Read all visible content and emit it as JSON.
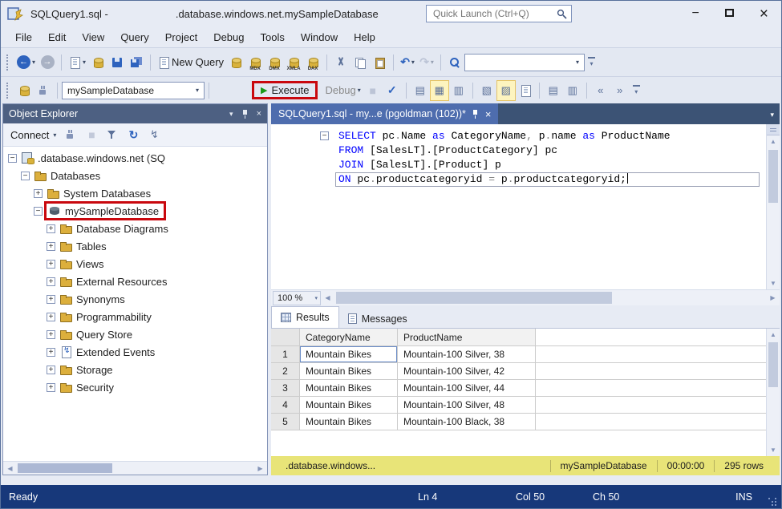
{
  "window": {
    "title_left": "SQLQuery1.sql -",
    "title_right": ".database.windows.net.mySampleDatabase",
    "quick_launch_placeholder": "Quick Launch (Ctrl+Q)"
  },
  "menu": {
    "items": [
      "File",
      "Edit",
      "View",
      "Query",
      "Project",
      "Debug",
      "Tools",
      "Window",
      "Help"
    ]
  },
  "toolbar1": {
    "new_query_label": "New Query",
    "query_types": [
      "",
      "MDX",
      "DMX",
      "XMLA",
      "DAX"
    ]
  },
  "toolbar2": {
    "database_combo_value": "mySampleDatabase",
    "execute_label": "Execute",
    "debug_label": "Debug"
  },
  "object_explorer": {
    "title": "Object Explorer",
    "connect_label": "Connect",
    "tree": [
      {
        "label": ".database.windows.net (SQ",
        "level": 0,
        "expand": "minus",
        "icon": "server"
      },
      {
        "label": "Databases",
        "level": 1,
        "expand": "minus",
        "icon": "folder"
      },
      {
        "label": "System Databases",
        "level": 2,
        "expand": "plus",
        "icon": "folder"
      },
      {
        "label": "mySampleDatabase",
        "level": 2,
        "expand": "minus",
        "icon": "database",
        "highlight": true
      },
      {
        "label": "Database Diagrams",
        "level": 3,
        "expand": "plus",
        "icon": "folder"
      },
      {
        "label": "Tables",
        "level": 3,
        "expand": "plus",
        "icon": "folder"
      },
      {
        "label": "Views",
        "level": 3,
        "expand": "plus",
        "icon": "folder"
      },
      {
        "label": "External Resources",
        "level": 3,
        "expand": "plus",
        "icon": "folder"
      },
      {
        "label": "Synonyms",
        "level": 3,
        "expand": "plus",
        "icon": "folder"
      },
      {
        "label": "Programmability",
        "level": 3,
        "expand": "plus",
        "icon": "folder"
      },
      {
        "label": "Query Store",
        "level": 3,
        "expand": "plus",
        "icon": "folder"
      },
      {
        "label": "Extended Events",
        "level": 3,
        "expand": "plus",
        "icon": "events"
      },
      {
        "label": "Storage",
        "level": 3,
        "expand": "plus",
        "icon": "folder"
      },
      {
        "label": "Security",
        "level": 3,
        "expand": "plus",
        "icon": "folder"
      }
    ]
  },
  "editor": {
    "tab_title": "SQLQuery1.sql - my...e (pgoldman (102))*",
    "zoom_level": "100 %",
    "code": [
      {
        "outline": true,
        "tokens": [
          [
            "SELECT ",
            "kw"
          ],
          [
            "pc",
            "id"
          ],
          [
            ".",
            "op"
          ],
          [
            "Name ",
            "id"
          ],
          [
            "as",
            "kw"
          ],
          [
            " CategoryName",
            "id"
          ],
          [
            ", ",
            "op"
          ],
          [
            "p",
            "id"
          ],
          [
            ".",
            "op"
          ],
          [
            "name ",
            "id"
          ],
          [
            "as",
            "kw"
          ],
          [
            " ProductName",
            "id"
          ]
        ]
      },
      {
        "tokens": [
          [
            "FROM ",
            "kw"
          ],
          [
            "[SalesLT].[ProductCategory] pc",
            "id"
          ]
        ]
      },
      {
        "tokens": [
          [
            "JOIN ",
            "kw"
          ],
          [
            "[SalesLT].[Product] p",
            "id"
          ]
        ]
      },
      {
        "current": true,
        "tokens": [
          [
            "ON ",
            "kw"
          ],
          [
            "pc",
            "id"
          ],
          [
            ".",
            "op"
          ],
          [
            "productcategoryid ",
            "id"
          ],
          [
            "=",
            "op"
          ],
          [
            " p",
            "id"
          ],
          [
            ".",
            "op"
          ],
          [
            "productcategoryid;",
            "id"
          ]
        ]
      }
    ]
  },
  "results": {
    "tabs": [
      "Results",
      "Messages"
    ],
    "columns": [
      "CategoryName",
      "ProductName"
    ],
    "rows": [
      [
        "Mountain Bikes",
        "Mountain-100 Silver, 38"
      ],
      [
        "Mountain Bikes",
        "Mountain-100 Silver, 42"
      ],
      [
        "Mountain Bikes",
        "Mountain-100 Silver, 44"
      ],
      [
        "Mountain Bikes",
        "Mountain-100 Silver, 48"
      ],
      [
        "Mountain Bikes",
        "Mountain-100 Black, 38"
      ]
    ],
    "status": {
      "server": ".database.windows...",
      "database": "mySampleDatabase",
      "time": "00:00:00",
      "row_count": "295 rows"
    }
  },
  "status_bar": {
    "state": "Ready",
    "line": "Ln 4",
    "column": "Col 50",
    "char": "Ch 50",
    "mode": "INS"
  },
  "icons": {
    "back": "←",
    "forward": "→",
    "caret": "▾",
    "undo": "↶",
    "redo": "↷",
    "refresh": "↻",
    "play": "▶",
    "stop": "■",
    "check": "✓",
    "close": "×",
    "minimize": "−",
    "up": "▲",
    "down": "▼",
    "left": "◀",
    "right": "▶",
    "bolt": "↯",
    "results-text": "▤",
    "results-grid": "▦",
    "results-file": "▥",
    "plan1": "▧",
    "plan2": "▨",
    "outdent": "«",
    "indent": "»"
  },
  "colors": {
    "accent_red": "#C9080E",
    "keyword_blue": "#0000FF",
    "azure_yellow": "#E8E478",
    "statusbar_blue": "#17387A"
  }
}
